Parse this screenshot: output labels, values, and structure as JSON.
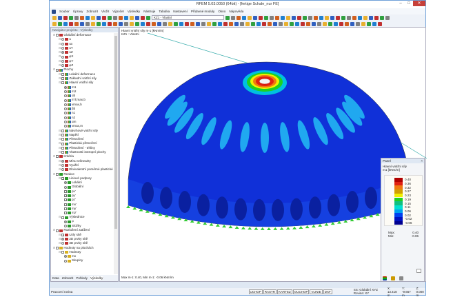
{
  "window": {
    "title": "RFEM 5.03.0050 (64bit) - [fertige Schale_nur FE]"
  },
  "menu": [
    "Soubor",
    "Úpravy",
    "Zobrazit",
    "Vložit",
    "Výpočet",
    "Výsledky",
    "Nástroje",
    "Tabulka",
    "Nastavení",
    "Přídavné moduly",
    "Okno",
    "Nápověda"
  ],
  "toolbar": {
    "loadcase": "KZ1 - Vlastní"
  },
  "navigator": {
    "title": "Navigátor projektu - Výsledky",
    "items": [
      {
        "label": "Globální deformace",
        "lvl": 0,
        "type": "cb",
        "icon": "deform"
      },
      {
        "label": "u",
        "lvl": 1,
        "type": "rb",
        "icon": "deform"
      },
      {
        "label": "ux",
        "lvl": 1,
        "type": "rb",
        "icon": "deform"
      },
      {
        "label": "uY",
        "lvl": 1,
        "type": "rb",
        "icon": "deform"
      },
      {
        "label": "uZ",
        "lvl": 1,
        "type": "rb",
        "on": true,
        "icon": "deform"
      },
      {
        "label": "φX",
        "lvl": 1,
        "type": "rb",
        "icon": "deform"
      },
      {
        "label": "φY",
        "lvl": 1,
        "type": "rb",
        "icon": "deform"
      },
      {
        "label": "φZ",
        "lvl": 1,
        "type": "rb",
        "icon": "deform"
      },
      {
        "label": "Plochy",
        "lvl": 0,
        "type": "cb",
        "on": true,
        "icon": "surf"
      },
      {
        "label": "Lokální deformace",
        "lvl": 1,
        "type": "cb",
        "icon": "surf"
      },
      {
        "label": "Základní vnitřní síly",
        "lvl": 1,
        "type": "cb",
        "icon": "surf"
      },
      {
        "label": "Hlavní vnitřní síly",
        "lvl": 1,
        "type": "cb",
        "icon": "surf"
      },
      {
        "label": "m1",
        "lvl": 2,
        "type": "rb",
        "on": true,
        "icon": "surf"
      },
      {
        "label": "m2",
        "lvl": 2,
        "type": "rb",
        "icon": "surf"
      },
      {
        "label": "αb",
        "lvl": 2,
        "type": "rb",
        "icon": "surf"
      },
      {
        "label": "mT,max,b",
        "lvl": 2,
        "type": "rb",
        "icon": "surf"
      },
      {
        "label": "vmax,b",
        "lvl": 2,
        "type": "rb",
        "icon": "surf"
      },
      {
        "label": "βb",
        "lvl": 2,
        "type": "rb",
        "icon": "surf"
      },
      {
        "label": "n1",
        "lvl": 2,
        "type": "rb",
        "icon": "surf"
      },
      {
        "label": "n2",
        "lvl": 2,
        "type": "rb",
        "icon": "surf"
      },
      {
        "label": "αm",
        "lvl": 2,
        "type": "rb",
        "icon": "surf"
      },
      {
        "label": "vmax,m",
        "lvl": 2,
        "type": "rb",
        "icon": "surf"
      },
      {
        "label": "Návrhové vnitřní síly",
        "lvl": 1,
        "type": "cb",
        "icon": "surf"
      },
      {
        "label": "Napětí",
        "lvl": 1,
        "type": "cb",
        "icon": "surf"
      },
      {
        "label": "Přetvoření",
        "lvl": 1,
        "type": "cb",
        "icon": "surf"
      },
      {
        "label": "Plastická přetvoření",
        "lvl": 1,
        "type": "cb",
        "icon": "surf"
      },
      {
        "label": "Přetvoření - trhliny",
        "lvl": 1,
        "type": "cb",
        "icon": "surf"
      },
      {
        "label": "Vlastnosti izotropní plochy",
        "lvl": 1,
        "type": "cb",
        "icon": "surf"
      },
      {
        "label": "Kritéria",
        "lvl": 0,
        "type": "cb",
        "icon": "deform"
      },
      {
        "label": "Míra nelinearity",
        "lvl": 1,
        "type": "rb",
        "on": true,
        "icon": "deform"
      },
      {
        "label": "Využití",
        "lvl": 1,
        "type": "rb",
        "icon": "deform"
      },
      {
        "label": "Ekvivalentní poměrné plastické",
        "lvl": 1,
        "type": "rb",
        "icon": "deform"
      },
      {
        "label": "Reakce",
        "lvl": 0,
        "type": "cb",
        "icon": "sup"
      },
      {
        "label": "Liniové podpory",
        "lvl": 1,
        "type": "cb",
        "on": true,
        "icon": "sup"
      },
      {
        "label": "Lokální",
        "lvl": 2,
        "type": "rb",
        "on": true,
        "icon": "sup"
      },
      {
        "label": "Globální",
        "lvl": 2,
        "type": "rb",
        "icon": "sup"
      },
      {
        "label": "px'",
        "lvl": 2,
        "type": "cb",
        "icon": "sup"
      },
      {
        "label": "py'",
        "lvl": 2,
        "type": "cb",
        "on": true,
        "icon": "sup"
      },
      {
        "label": "pz'",
        "lvl": 2,
        "type": "cb",
        "on": true,
        "icon": "sup"
      },
      {
        "label": "mx'",
        "lvl": 2,
        "type": "cb",
        "icon": "sup"
      },
      {
        "label": "my'",
        "lvl": 2,
        "type": "cb",
        "icon": "sup"
      },
      {
        "label": "mz'",
        "lvl": 2,
        "type": "cb",
        "icon": "sup"
      },
      {
        "label": "Výslednice",
        "lvl": 1,
        "type": "cb",
        "icon": "sup"
      },
      {
        "label": "P",
        "lvl": 2,
        "type": "rb",
        "on": true,
        "icon": "sup"
      },
      {
        "label": "Složky",
        "lvl": 2,
        "type": "rb",
        "icon": "sup"
      },
      {
        "label": "Rozložení zatížení",
        "lvl": 0,
        "type": "cb",
        "icon": "deform"
      },
      {
        "label": "Uzly sítě",
        "lvl": 1,
        "type": "cb",
        "on": true,
        "icon": "deform"
      },
      {
        "label": "2D prvky sítě",
        "lvl": 1,
        "type": "rb",
        "on": true,
        "icon": "deform"
      },
      {
        "label": "3D prvky sítě",
        "lvl": 1,
        "type": "rb",
        "icon": "deform"
      },
      {
        "label": "Hodnoty na plochách",
        "lvl": 0,
        "type": "cb",
        "icon": "val"
      },
      {
        "label": "Hodnoty",
        "lvl": 1,
        "type": "cb",
        "icon": "val"
      },
      {
        "label": "mx",
        "lvl": 2,
        "type": "rb",
        "on": true,
        "icon": "val"
      },
      {
        "label": "Skupiny",
        "lvl": 2,
        "type": "rb",
        "icon": "val"
      }
    ],
    "tabs": [
      "Data",
      "Zobrazit",
      "Pohledy",
      "Výsledky"
    ]
  },
  "view": {
    "info1": "Hlavní vnitřní síly m-1 [kNm/m]",
    "info2": "KZ1 : Vlastní",
    "footer": "Max m-1: 0.40, Min m-1: -0.06 kNm/m"
  },
  "panel": {
    "title": "Panel",
    "heading": "Hlavní vnitřní síly",
    "unit": "m1 [kNm/m]",
    "legend": [
      {
        "v": "0.40",
        "c": "#b00000"
      },
      {
        "v": "0.36",
        "c": "#e02010"
      },
      {
        "v": "0.32",
        "c": "#f07810"
      },
      {
        "v": "0.27",
        "c": "#d0a000"
      },
      {
        "v": "0.23",
        "c": "#f0f000"
      },
      {
        "v": "0.19",
        "c": "#20d020"
      },
      {
        "v": "0.15",
        "c": "#10c080"
      },
      {
        "v": "0.11",
        "c": "#00e0d0"
      },
      {
        "v": "0.06",
        "c": "#00a0f0"
      },
      {
        "v": "0.02",
        "c": "#0040f0"
      },
      {
        "v": "-0.02",
        "c": "#0010c0"
      },
      {
        "v": "-0.06",
        "c": "#000090"
      }
    ],
    "max_label": "Max:",
    "max": "0.40",
    "min_label": "Min:",
    "min": "-0.06"
  },
  "status": {
    "left": "Pracovní rovina",
    "buttons": [
      "UCHOP",
      "RASTR",
      "KARTEZ",
      "OUCHOP",
      "VLINIE",
      "DXF"
    ],
    "cs": "SS: Globální XYZ  Rovina: XY",
    "x": "X: 13.418 m",
    "y": "Y: -9.667 m",
    "z": "Z: 0.000 m"
  }
}
